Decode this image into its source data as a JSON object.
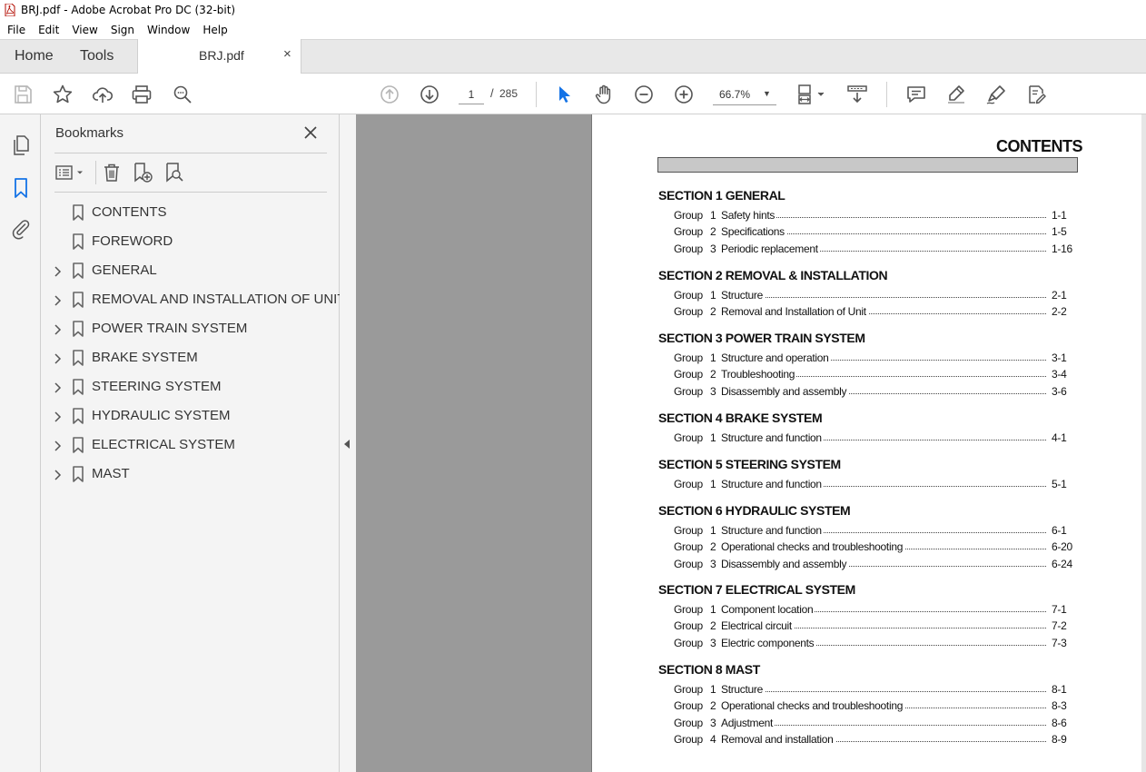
{
  "window": {
    "title": "BRJ.pdf - Adobe Acrobat Pro DC (32-bit)"
  },
  "menu": [
    "File",
    "Edit",
    "View",
    "Sign",
    "Window",
    "Help"
  ],
  "tabs": {
    "home": "Home",
    "tools": "Tools",
    "document": "BRJ.pdf",
    "close": "×"
  },
  "toolbar": {
    "page_current": "1",
    "page_sep": "/",
    "page_total": "285",
    "zoom": "66.7%"
  },
  "bookmarks": {
    "title": "Bookmarks",
    "items": [
      {
        "label": "CONTENTS",
        "expandable": false
      },
      {
        "label": "FOREWORD",
        "expandable": false
      },
      {
        "label": "GENERAL",
        "expandable": true
      },
      {
        "label": "REMOVAL AND INSTALLATION OF UNIT",
        "expandable": true
      },
      {
        "label": "POWER TRAIN SYSTEM",
        "expandable": true
      },
      {
        "label": "BRAKE SYSTEM",
        "expandable": true
      },
      {
        "label": "STEERING SYSTEM",
        "expandable": true
      },
      {
        "label": "HYDRAULIC SYSTEM",
        "expandable": true
      },
      {
        "label": "ELECTRICAL SYSTEM",
        "expandable": true
      },
      {
        "label": "MAST",
        "expandable": true
      }
    ]
  },
  "toc": {
    "title": "CONTENTS",
    "sections": [
      {
        "heading": "SECTION 1  GENERAL",
        "groups": [
          {
            "g": "Group",
            "n": "1",
            "t": "Safety hints",
            "p": "1-1"
          },
          {
            "g": "Group",
            "n": "2",
            "t": "Specifications",
            "p": "1-5"
          },
          {
            "g": "Group",
            "n": "3",
            "t": "Periodic replacement",
            "p": "1-16"
          }
        ]
      },
      {
        "heading": "SECTION 2  REMOVAL & INSTALLATION",
        "groups": [
          {
            "g": "Group",
            "n": "1",
            "t": "Structure",
            "p": "2-1"
          },
          {
            "g": "Group",
            "n": "2",
            "t": "Removal and Installation of Unit",
            "p": "2-2"
          }
        ]
      },
      {
        "heading": "SECTION 3  POWER TRAIN SYSTEM",
        "groups": [
          {
            "g": "Group",
            "n": "1",
            "t": "Structure and operation",
            "p": "3-1"
          },
          {
            "g": "Group",
            "n": "2",
            "t": "Troubleshooting",
            "p": "3-4"
          },
          {
            "g": "Group",
            "n": "3",
            "t": "Disassembly and assembly",
            "p": "3-6"
          }
        ]
      },
      {
        "heading": "SECTION 4  BRAKE SYSTEM",
        "groups": [
          {
            "g": "Group",
            "n": "1",
            "t": "Structure and function",
            "p": "4-1"
          }
        ]
      },
      {
        "heading": "SECTION 5  STEERING SYSTEM",
        "groups": [
          {
            "g": "Group",
            "n": "1",
            "t": "Structure and function",
            "p": "5-1"
          }
        ]
      },
      {
        "heading": "SECTION 6  HYDRAULIC SYSTEM",
        "groups": [
          {
            "g": "Group",
            "n": "1",
            "t": "Structure and function",
            "p": "6-1"
          },
          {
            "g": "Group",
            "n": "2",
            "t": "Operational checks and troubleshooting",
            "p": "6-20"
          },
          {
            "g": "Group",
            "n": "3",
            "t": "Disassembly and assembly",
            "p": "6-24"
          }
        ]
      },
      {
        "heading": "SECTION 7  ELECTRICAL SYSTEM",
        "groups": [
          {
            "g": "Group",
            "n": "1",
            "t": "Component location",
            "p": "7-1"
          },
          {
            "g": "Group",
            "n": "2",
            "t": "Electrical circuit",
            "p": "7-2"
          },
          {
            "g": "Group",
            "n": "3",
            "t": "Electric components",
            "p": "7-3"
          }
        ]
      },
      {
        "heading": "SECTION 8  MAST",
        "groups": [
          {
            "g": "Group",
            "n": "1",
            "t": "Structure",
            "p": "8-1"
          },
          {
            "g": "Group",
            "n": "2",
            "t": "Operational checks and troubleshooting",
            "p": "8-3"
          },
          {
            "g": "Group",
            "n": "3",
            "t": "Adjustment",
            "p": "8-6"
          },
          {
            "g": "Group",
            "n": "4",
            "t": "Removal and installation",
            "p": "8-9"
          }
        ]
      }
    ]
  },
  "colors": {
    "accent": "#1473e6",
    "toolbar_icon": "#555555",
    "doc_bg": "#9a9a9a"
  }
}
